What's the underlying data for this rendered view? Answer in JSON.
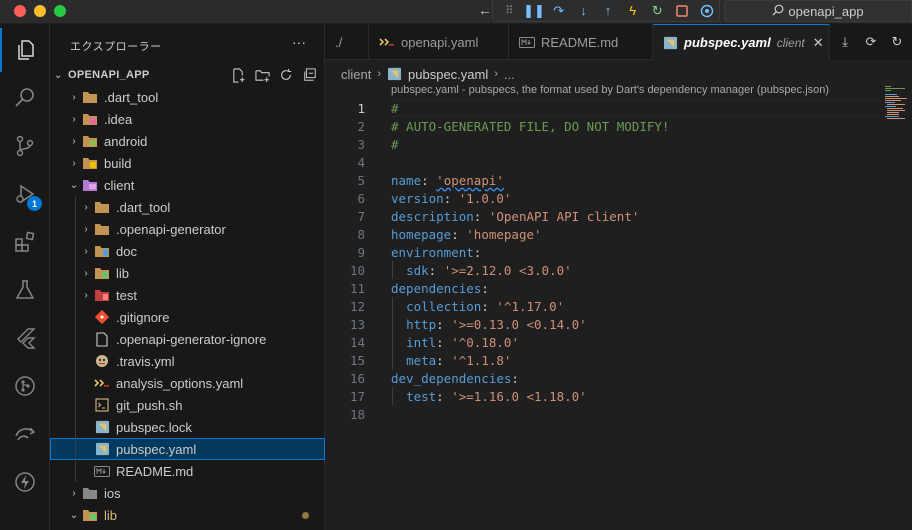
{
  "search": {
    "label": "openapi_app"
  },
  "activity": {
    "debug_badge": "1"
  },
  "explorer": {
    "title": "エクスプローラー",
    "more": "···",
    "section": "OPENAPI_APP",
    "items": [
      {
        "label": ".dart_tool",
        "twisty": "›",
        "icon": "folder",
        "level": 0
      },
      {
        "label": ".idea",
        "twisty": "›",
        "icon": "folder-idea",
        "level": 0
      },
      {
        "label": "android",
        "twisty": "›",
        "icon": "folder-android",
        "level": 0
      },
      {
        "label": "build",
        "twisty": "›",
        "icon": "folder-build",
        "level": 0
      },
      {
        "label": "client",
        "twisty": "⌄",
        "icon": "folder-client",
        "level": 0
      },
      {
        "label": ".dart_tool",
        "twisty": "›",
        "icon": "folder",
        "level": 1
      },
      {
        "label": ".openapi-generator",
        "twisty": "›",
        "icon": "folder",
        "level": 1
      },
      {
        "label": "doc",
        "twisty": "›",
        "icon": "folder-doc",
        "level": 1
      },
      {
        "label": "lib",
        "twisty": "›",
        "icon": "folder-lib",
        "level": 1
      },
      {
        "label": "test",
        "twisty": "›",
        "icon": "folder-test",
        "level": 1
      },
      {
        "label": ".gitignore",
        "twisty": "",
        "icon": "git",
        "level": 1
      },
      {
        "label": ".openapi-generator-ignore",
        "twisty": "",
        "icon": "file",
        "level": 1
      },
      {
        "label": ".travis.yml",
        "twisty": "",
        "icon": "travis",
        "level": 1
      },
      {
        "label": "analysis_options.yaml",
        "twisty": "",
        "icon": "yaml",
        "level": 1
      },
      {
        "label": "git_push.sh",
        "twisty": "",
        "icon": "shell",
        "level": 1
      },
      {
        "label": "pubspec.lock",
        "twisty": "",
        "icon": "dart-file",
        "level": 1
      },
      {
        "label": "pubspec.yaml",
        "twisty": "",
        "icon": "dart-file",
        "level": 1,
        "selected": true
      },
      {
        "label": "README.md",
        "twisty": "",
        "icon": "markdown",
        "level": 1
      },
      {
        "label": "ios",
        "twisty": "›",
        "icon": "folder-ios",
        "level": 0
      },
      {
        "label": "lib",
        "twisty": "⌄",
        "icon": "folder-lib",
        "level": 0,
        "modified": true
      }
    ]
  },
  "tabs": [
    {
      "label": "./",
      "icon": ""
    },
    {
      "label": "openapi.yaml",
      "icon": "yaml"
    },
    {
      "label": "README.md",
      "icon": "markdown"
    },
    {
      "label": "pubspec.yaml",
      "icon": "dart-file",
      "desc": "client",
      "active": true
    }
  ],
  "breadcrumb": {
    "folder": "client",
    "file": "pubspec.yaml",
    "more": "..."
  },
  "schema_hint": "pubspec.yaml - pubspecs, the format used by Dart's dependency manager (pubspec.json)",
  "code": [
    {
      "n": "1",
      "parts": [
        [
          "c-comment",
          "#"
        ]
      ]
    },
    {
      "n": "2",
      "parts": [
        [
          "c-comment",
          "# AUTO-GENERATED FILE, DO NOT MODIFY!"
        ]
      ]
    },
    {
      "n": "3",
      "parts": [
        [
          "c-comment",
          "#"
        ]
      ]
    },
    {
      "n": "4",
      "parts": []
    },
    {
      "n": "5",
      "parts": [
        [
          "c-key",
          "name"
        ],
        [
          "c-plain",
          ": "
        ],
        [
          "c-str squiggle",
          "'openapi'"
        ]
      ]
    },
    {
      "n": "6",
      "parts": [
        [
          "c-key",
          "version"
        ],
        [
          "c-plain",
          ": "
        ],
        [
          "c-str",
          "'1.0.0'"
        ]
      ]
    },
    {
      "n": "7",
      "parts": [
        [
          "c-key",
          "description"
        ],
        [
          "c-plain",
          ": "
        ],
        [
          "c-str",
          "'OpenAPI API client'"
        ]
      ]
    },
    {
      "n": "8",
      "parts": [
        [
          "c-key",
          "homepage"
        ],
        [
          "c-plain",
          ": "
        ],
        [
          "c-str",
          "'homepage'"
        ]
      ]
    },
    {
      "n": "9",
      "parts": [
        [
          "c-key",
          "environment"
        ],
        [
          "c-plain",
          ":"
        ]
      ]
    },
    {
      "n": "10",
      "parts": [
        [
          "c-plain",
          "  "
        ],
        [
          "c-key",
          "sdk"
        ],
        [
          "c-plain",
          ": "
        ],
        [
          "c-str",
          "'>=2.12.0 <3.0.0'"
        ]
      ]
    },
    {
      "n": "11",
      "parts": [
        [
          "c-key",
          "dependencies"
        ],
        [
          "c-plain",
          ":"
        ]
      ]
    },
    {
      "n": "12",
      "parts": [
        [
          "c-plain",
          "  "
        ],
        [
          "c-key",
          "collection"
        ],
        [
          "c-plain",
          ": "
        ],
        [
          "c-str",
          "'^1.17.0'"
        ]
      ]
    },
    {
      "n": "13",
      "parts": [
        [
          "c-plain",
          "  "
        ],
        [
          "c-key",
          "http"
        ],
        [
          "c-plain",
          ": "
        ],
        [
          "c-str",
          "'>=0.13.0 <0.14.0'"
        ]
      ]
    },
    {
      "n": "14",
      "parts": [
        [
          "c-plain",
          "  "
        ],
        [
          "c-key",
          "intl"
        ],
        [
          "c-plain",
          ": "
        ],
        [
          "c-str",
          "'^0.18.0'"
        ]
      ]
    },
    {
      "n": "15",
      "parts": [
        [
          "c-plain",
          "  "
        ],
        [
          "c-key",
          "meta"
        ],
        [
          "c-plain",
          ": "
        ],
        [
          "c-str",
          "'^1.1.8'"
        ]
      ]
    },
    {
      "n": "16",
      "parts": [
        [
          "c-key",
          "dev_dependencies"
        ],
        [
          "c-plain",
          ":"
        ]
      ]
    },
    {
      "n": "17",
      "parts": [
        [
          "c-plain",
          "  "
        ],
        [
          "c-key",
          "test"
        ],
        [
          "c-plain",
          ": "
        ],
        [
          "c-str",
          "'>=1.16.0 <1.18.0'"
        ]
      ]
    },
    {
      "n": "18",
      "parts": []
    }
  ],
  "colors": {
    "accent": "#0078d4",
    "selection": "#04395e",
    "comment": "#6a9955",
    "key": "#569cd6",
    "string": "#ce9178"
  }
}
